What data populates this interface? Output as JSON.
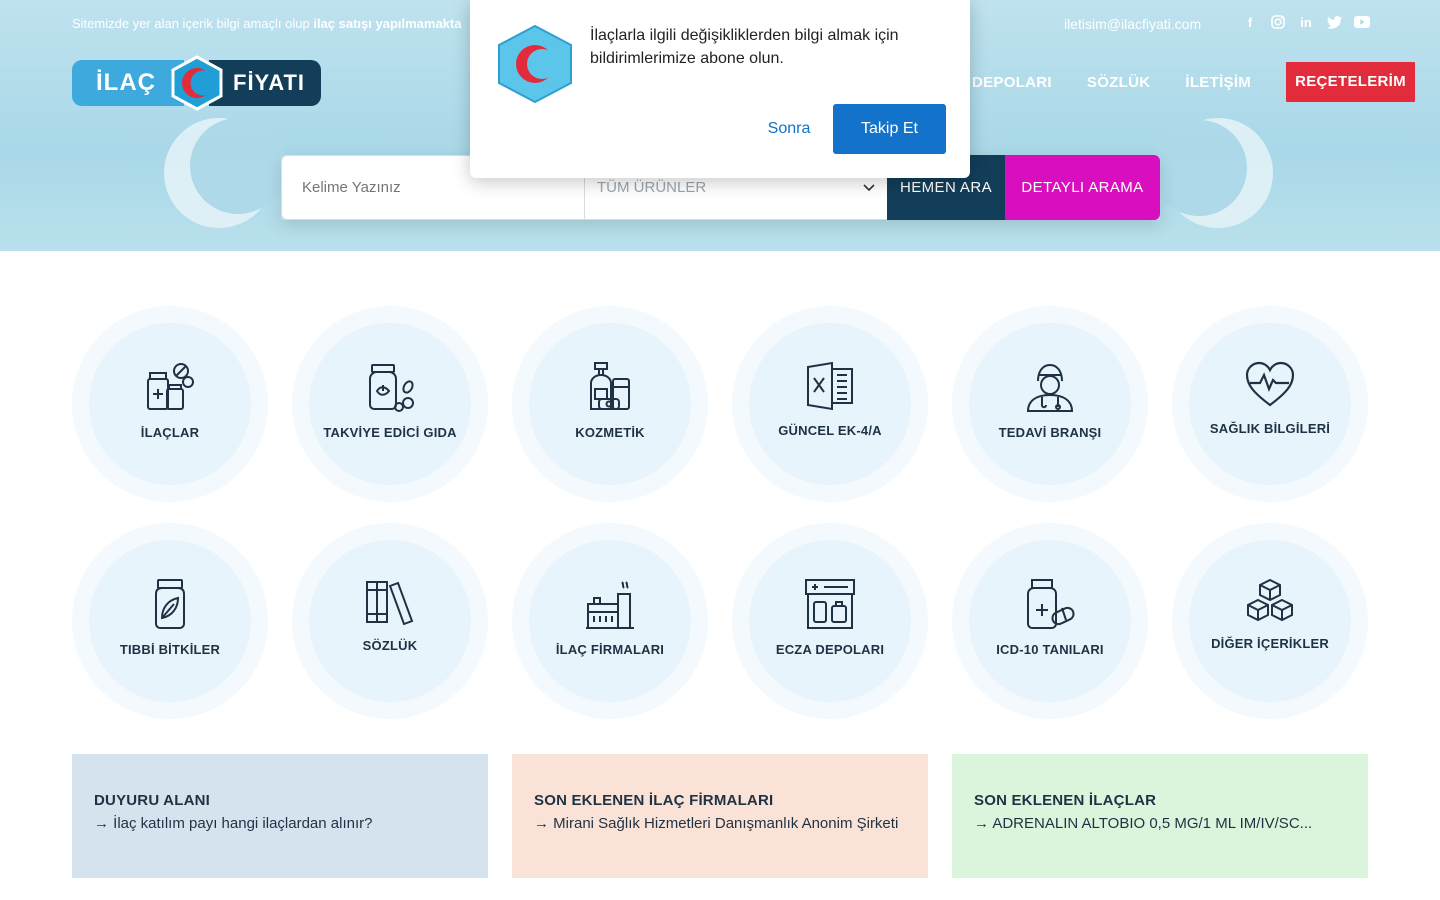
{
  "topbar": {
    "note_prefix": "Sitemizde yer alan içerik bilgi amaçlı olup ",
    "note_bold": "ilaç satışı yapılmamakta",
    "email": "iletisim@ilacfiyati.com",
    "social": [
      "f",
      "◎",
      "in",
      "🐦",
      "▶"
    ]
  },
  "logo": {
    "left": "İLAÇ",
    "right": "FİYATI"
  },
  "nav": {
    "items": [
      "DEPOLARI",
      "SÖZLÜK",
      "İLETİŞİM"
    ],
    "cta": "REÇETELERİM"
  },
  "search": {
    "placeholder": "Kelime Yazınız",
    "category": "TÜM ÜRÜNLER",
    "submit": "HEMEN ARA",
    "advanced": "DETAYLI ARAMA"
  },
  "categories": [
    {
      "label": "İLAÇLAR",
      "icon": "medicine-icon"
    },
    {
      "label": "TAKVİYE EDİCİ GIDA",
      "icon": "supplement-icon"
    },
    {
      "label": "KOZMETİK",
      "icon": "cosmetics-icon"
    },
    {
      "label": "GÜNCEL EK-4/A",
      "icon": "excel-doc-icon"
    },
    {
      "label": "TEDAVİ BRANŞI",
      "icon": "doctor-icon"
    },
    {
      "label": "SAĞLIK BİLGİLERİ",
      "icon": "heart-pulse-icon"
    },
    {
      "label": "TIBBİ BİTKİLER",
      "icon": "herb-jar-icon"
    },
    {
      "label": "SÖZLÜK",
      "icon": "books-icon"
    },
    {
      "label": "İLAÇ FİRMALARI",
      "icon": "factory-icon"
    },
    {
      "label": "ECZA DEPOLARI",
      "icon": "pharmacy-store-icon"
    },
    {
      "label": "ICD-10 TANILARI",
      "icon": "pill-bottle-icon"
    },
    {
      "label": "DİĞER İÇERİKLER",
      "icon": "boxes-icon"
    }
  ],
  "cards": [
    {
      "title": "DUYURU ALANI",
      "text": "→ İlaç katılım payı hangi ilaçlardan alınır?"
    },
    {
      "title": "SON EKLENEN İLAÇ FİRMALARI",
      "text": "→ Mirani Sağlık Hizmetleri Danışmanlık Anonim Şirketi"
    },
    {
      "title": "SON EKLENEN İLAÇLAR",
      "text": "→ ADRENALIN ALTOBIO 0,5 MG/1 ML IM/IV/SC..."
    }
  ],
  "popup": {
    "message": "İlaçlarla ilgili değişikliklerden bilgi almak için bildirimlerimize abone olun.",
    "later": "Sonra",
    "follow": "Takip Et"
  },
  "colors": {
    "brand_dark": "#123e5a",
    "brand_light": "#3ea9dc",
    "cta_red": "#e22b3b",
    "advanced_magenta": "#d90fbf",
    "push_blue": "#1372c9"
  }
}
